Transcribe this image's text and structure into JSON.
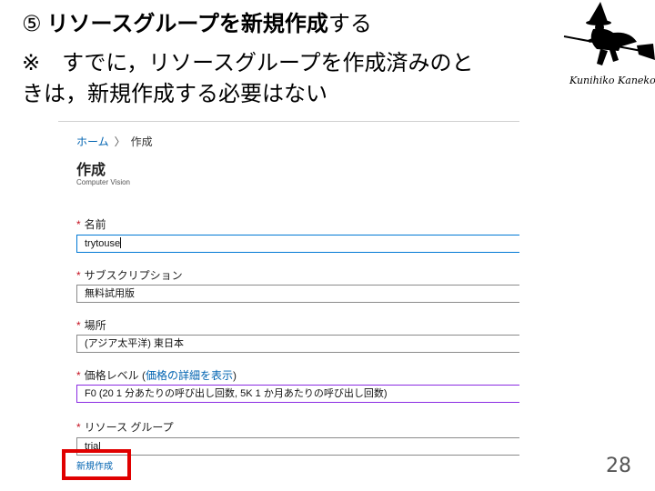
{
  "slide": {
    "title_number": "⑤",
    "title_bold": "リソースグループを新規作成",
    "title_rest": "する",
    "note_line1": "※　すでに，リソースグループを作成済みのと",
    "note_line2": "きは，新規作成する必要はない",
    "logo_text": "Kunihiko Kaneko Lab.",
    "page_number": "28"
  },
  "portal": {
    "breadcrumb": {
      "home": "ホーム",
      "separator": "〉",
      "current": "作成"
    },
    "blade_title": "作成",
    "blade_subtitle": "Computer Vision",
    "required_mark": "*",
    "fields": {
      "name": {
        "label": "名前",
        "value": "trytouse"
      },
      "subscription": {
        "label": "サブスクリプション",
        "value": "無料試用版"
      },
      "location": {
        "label": "場所",
        "value": "(アジア太平洋) 東日本"
      },
      "pricing": {
        "label": "価格レベル (",
        "link": "価格の詳細を表示",
        "label_end": ")",
        "value": "F0 (20 1 分あたりの呼び出し回数, 5K 1 か月あたりの呼び出し回数)"
      },
      "resource_group": {
        "label": "リソース グループ",
        "value": "trial"
      }
    },
    "create_new_link": "新規作成"
  },
  "colors": {
    "highlight": "#e00000",
    "link": "#0063b1",
    "required": "#c50f1f"
  }
}
